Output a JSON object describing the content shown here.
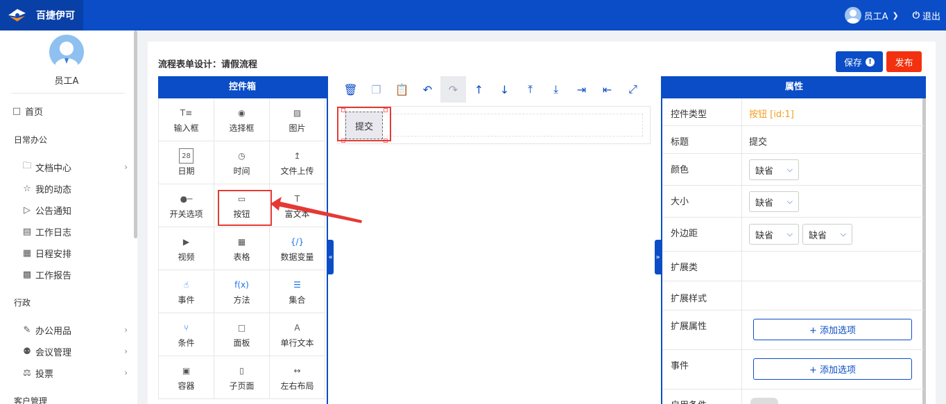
{
  "app": {
    "brand": "百捷伊可"
  },
  "header": {
    "user": "员工A",
    "logout": "退出"
  },
  "sidebar": {
    "user_name": "员工A",
    "home": "首页",
    "groups": [
      {
        "label": "日常办公"
      },
      {
        "label": "行政"
      },
      {
        "label": "客户管理"
      }
    ],
    "items": [
      {
        "label": "文档中心",
        "icon": "folder-icon"
      },
      {
        "label": "我的动态",
        "icon": "star-icon"
      },
      {
        "label": "公告通知",
        "icon": "speaker-icon"
      },
      {
        "label": "工作日志",
        "icon": "log-icon"
      },
      {
        "label": "日程安排",
        "icon": "calendar-icon"
      },
      {
        "label": "工作报告",
        "icon": "report-icon"
      },
      {
        "label": "办公用品",
        "icon": "edit-icon"
      },
      {
        "label": "会议管理",
        "icon": "meeting-icon"
      },
      {
        "label": "投票",
        "icon": "vote-icon"
      }
    ]
  },
  "page": {
    "title": "流程表单设计：请假流程",
    "save": "保存",
    "publish": "发布"
  },
  "widget_box": {
    "title": "控件箱",
    "items": [
      {
        "label": "输入框",
        "icon": "text-input-icon"
      },
      {
        "label": "选择框",
        "icon": "radio-icon"
      },
      {
        "label": "图片",
        "icon": "image-icon"
      },
      {
        "label": "日期",
        "icon": "date-icon"
      },
      {
        "label": "时间",
        "icon": "clock-icon"
      },
      {
        "label": "文件上传",
        "icon": "upload-icon"
      },
      {
        "label": "开关选项",
        "icon": "switch-icon"
      },
      {
        "label": "按钮",
        "icon": "button-icon"
      },
      {
        "label": "富文本",
        "icon": "richtext-icon"
      },
      {
        "label": "视频",
        "icon": "video-icon"
      },
      {
        "label": "表格",
        "icon": "table-icon"
      },
      {
        "label": "数据变量",
        "icon": "variable-icon"
      },
      {
        "label": "事件",
        "icon": "event-icon"
      },
      {
        "label": "方法",
        "icon": "function-icon"
      },
      {
        "label": "集合",
        "icon": "collection-icon"
      },
      {
        "label": "条件",
        "icon": "condition-icon"
      },
      {
        "label": "面板",
        "icon": "panel-icon"
      },
      {
        "label": "单行文本",
        "icon": "singleline-icon"
      },
      {
        "label": "容器",
        "icon": "container-icon"
      },
      {
        "label": "子页面",
        "icon": "subpage-icon"
      },
      {
        "label": "左右布局",
        "icon": "layout-icon"
      }
    ]
  },
  "canvas": {
    "button_text": "提交"
  },
  "properties": {
    "title": "属性",
    "rows": {
      "type_label": "控件类型",
      "type_value": "按钮 [id:1]",
      "title_label": "标题",
      "title_value": "提交",
      "color_label": "颜色",
      "color_value": "缺省",
      "size_label": "大小",
      "size_value": "缺省",
      "margin_label": "外边距",
      "margin_value_1": "缺省",
      "margin_value_2": "缺省",
      "ext_class_label": "扩展类",
      "ext_style_label": "扩展样式",
      "ext_attr_label": "扩展属性",
      "ext_attr_button": "+ 添加选项",
      "event_label": "事件",
      "event_button": "+ 添加选项",
      "enable_label": "启用条件"
    }
  },
  "colors": {
    "primary": "#0a4dc7",
    "danger": "#f2320f",
    "highlight": "#e53935",
    "accent_text": "#f0a020"
  }
}
